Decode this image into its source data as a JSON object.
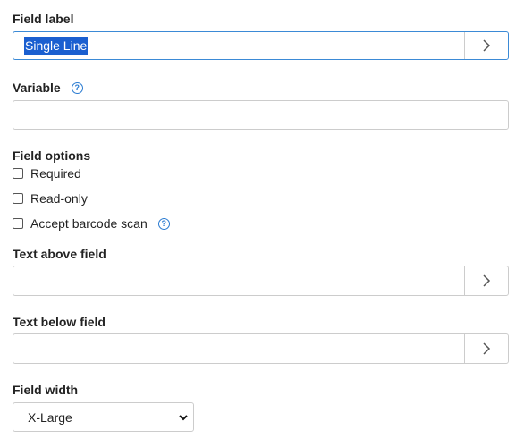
{
  "field_label": {
    "label": "Field label",
    "value": "Single Line"
  },
  "variable": {
    "label": "Variable",
    "help_icon": "help-circle-icon",
    "value": ""
  },
  "field_options": {
    "label": "Field options",
    "options": [
      {
        "label": "Required",
        "checked": false
      },
      {
        "label": "Read-only",
        "checked": false
      },
      {
        "label": "Accept barcode scan",
        "checked": false,
        "help_icon": "help-circle-icon"
      }
    ]
  },
  "text_above": {
    "label": "Text above field",
    "value": ""
  },
  "text_below": {
    "label": "Text below field",
    "value": ""
  },
  "field_width": {
    "label": "Field width",
    "selected": "X-Large"
  },
  "colors": {
    "focus_border": "#3b8ad6",
    "selection": "#1a5fd0",
    "help_icon": "#2a7bd1",
    "border": "#cccccc"
  }
}
